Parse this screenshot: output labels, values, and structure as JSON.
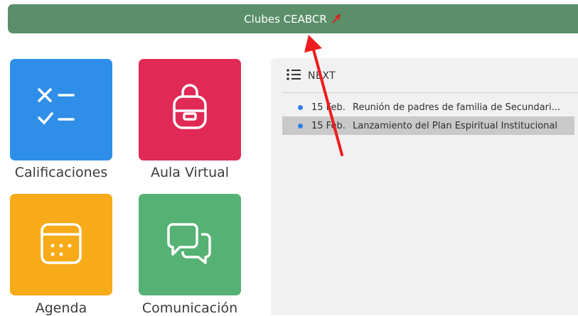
{
  "header": {
    "title": "Clubes CEABCR"
  },
  "tiles": [
    {
      "label": "Calificaciones",
      "color": "#2f8fe8",
      "icon": "checklist-icon"
    },
    {
      "label": "Aula Virtual",
      "color": "#e02a55",
      "icon": "backpack-icon"
    },
    {
      "label": "Agenda",
      "color": "#f7ab18",
      "icon": "calendar-icon"
    },
    {
      "label": "Comunicación",
      "color": "#55b274",
      "icon": "chat-icon"
    }
  ],
  "next_panel": {
    "header": "NEXT",
    "events": [
      {
        "date": "15 Feb.",
        "title": "Reunión de padres de familia de Secundari..."
      },
      {
        "date": "15 Feb.",
        "title": "Lanzamiento del Plan Espiritual Institucional"
      }
    ]
  }
}
